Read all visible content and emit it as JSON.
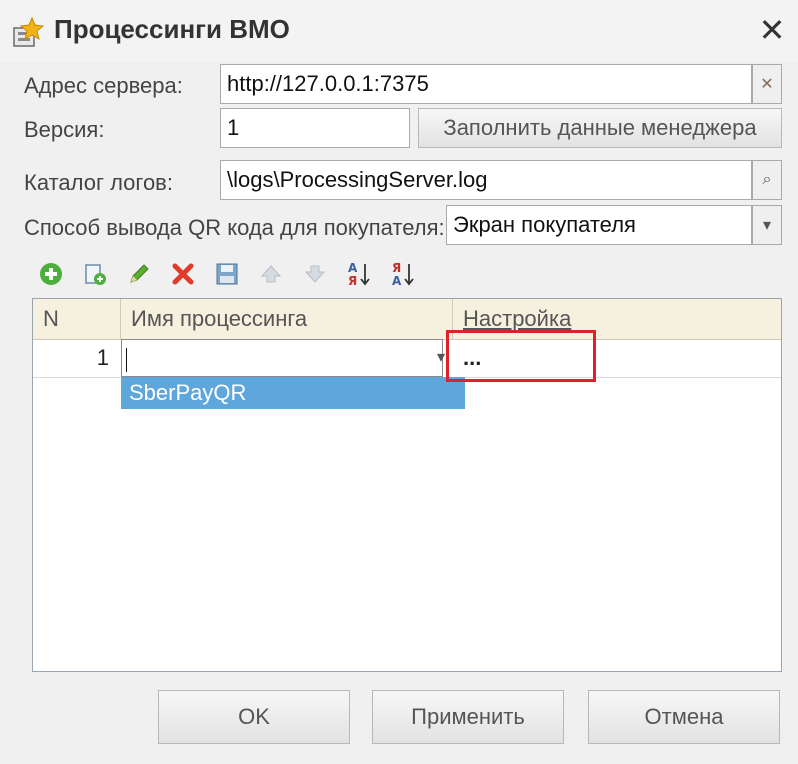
{
  "window": {
    "title": "Процессинги ВМО",
    "close_glyph": "✕"
  },
  "form": {
    "server_address": {
      "label": "Адрес сервера:",
      "value": "http://127.0.0.1:7375",
      "clear_glyph": "✕"
    },
    "version": {
      "label": "Версия:",
      "value": "1"
    },
    "fill_manager_button": "Заполнить данные менеджера",
    "log_catalog": {
      "label": "Каталог логов:",
      "value": "\\logs\\ProcessingServer.log",
      "search_glyph": "⌕"
    },
    "qr_output": {
      "label": "Способ вывода QR кода для покупателя:",
      "value": "Экран покупателя",
      "arrow_glyph": "▾"
    }
  },
  "toolbar": {
    "icons": [
      "add-icon",
      "copy-icon",
      "edit-icon",
      "delete-icon",
      "save-icon",
      "move-up-icon",
      "move-down-icon",
      "sort-asc-icon",
      "sort-desc-icon"
    ]
  },
  "table": {
    "columns": [
      "N",
      "Имя процессинга",
      "Настройка"
    ],
    "rows": [
      {
        "n": "1",
        "name": "",
        "settings": "..."
      }
    ],
    "dropdown_options": [
      "SberPayQR"
    ],
    "arrow_glyph": "▾"
  },
  "buttons": {
    "ok": "OK",
    "apply": "Применить",
    "cancel": "Отмена"
  },
  "colors": {
    "highlight_box": "#e0202a",
    "dropdown_selected": "#5ea6dc",
    "header_bg": "#f6f1df"
  }
}
